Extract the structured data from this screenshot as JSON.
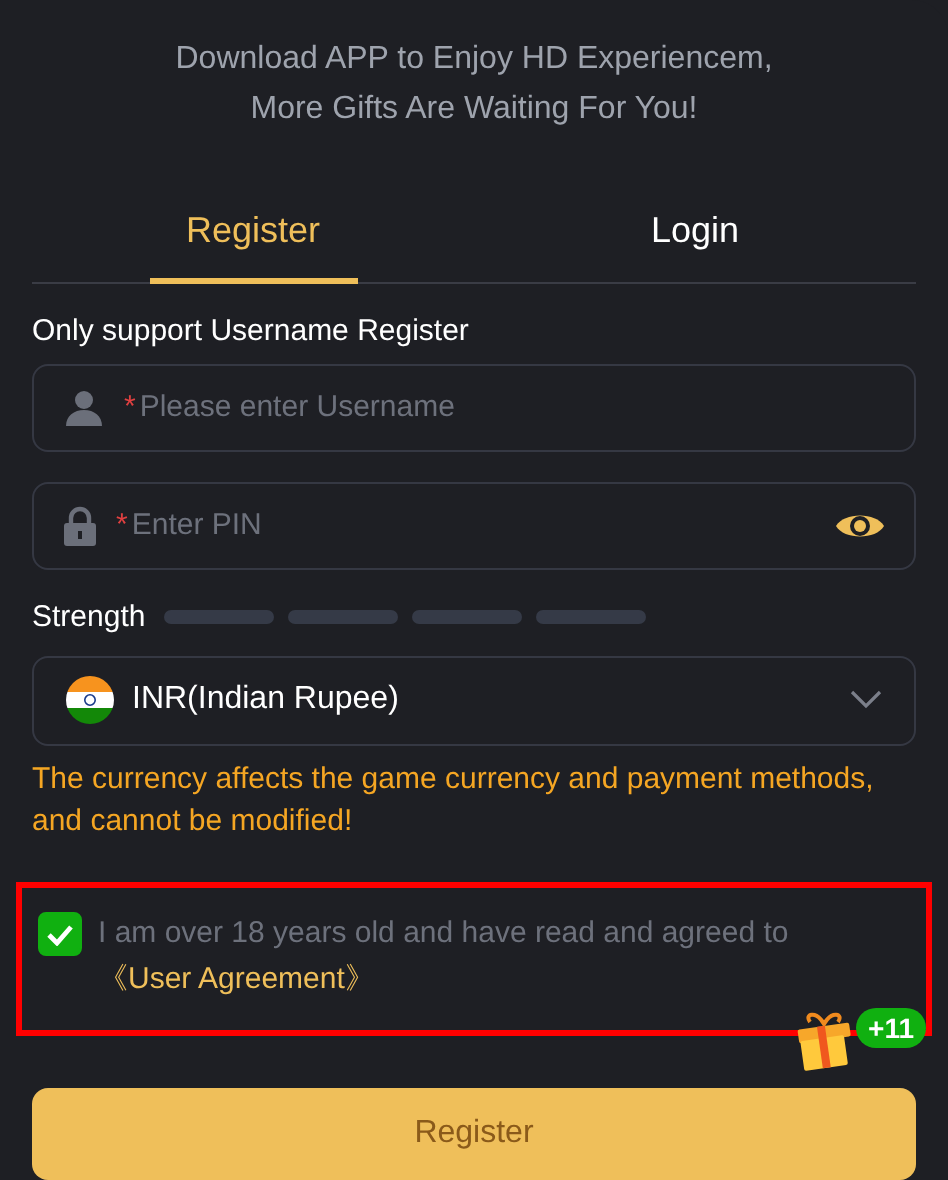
{
  "promo": {
    "lines": [
      "Download APP to Enjoy HD Experiencem,",
      "More Gifts Are Waiting For You!"
    ]
  },
  "tabs": [
    {
      "label": "Register",
      "selected": true
    },
    {
      "label": "Login",
      "selected": false
    }
  ],
  "note": "Only support Username Register",
  "fields": [
    {
      "kind": "user",
      "required_mark": "*",
      "placeholder": "Please enter Username"
    },
    {
      "kind": "pin",
      "required_mark": "*",
      "placeholder": "Enter PIN",
      "reveal": true
    }
  ],
  "strength": {
    "label": "Strength"
  },
  "currency": {
    "value": "INR(Indian Rupee)"
  },
  "warning": "The currency affects the game currency and payment methods, and cannot be modified!",
  "agreement": {
    "checked": true,
    "text": "I am over 18 years old and have read and agreed to ",
    "link": "《User Agreement》",
    "highlighted": true
  },
  "gift_badge": {
    "count": "+11"
  },
  "submit": {
    "label": "Register"
  }
}
